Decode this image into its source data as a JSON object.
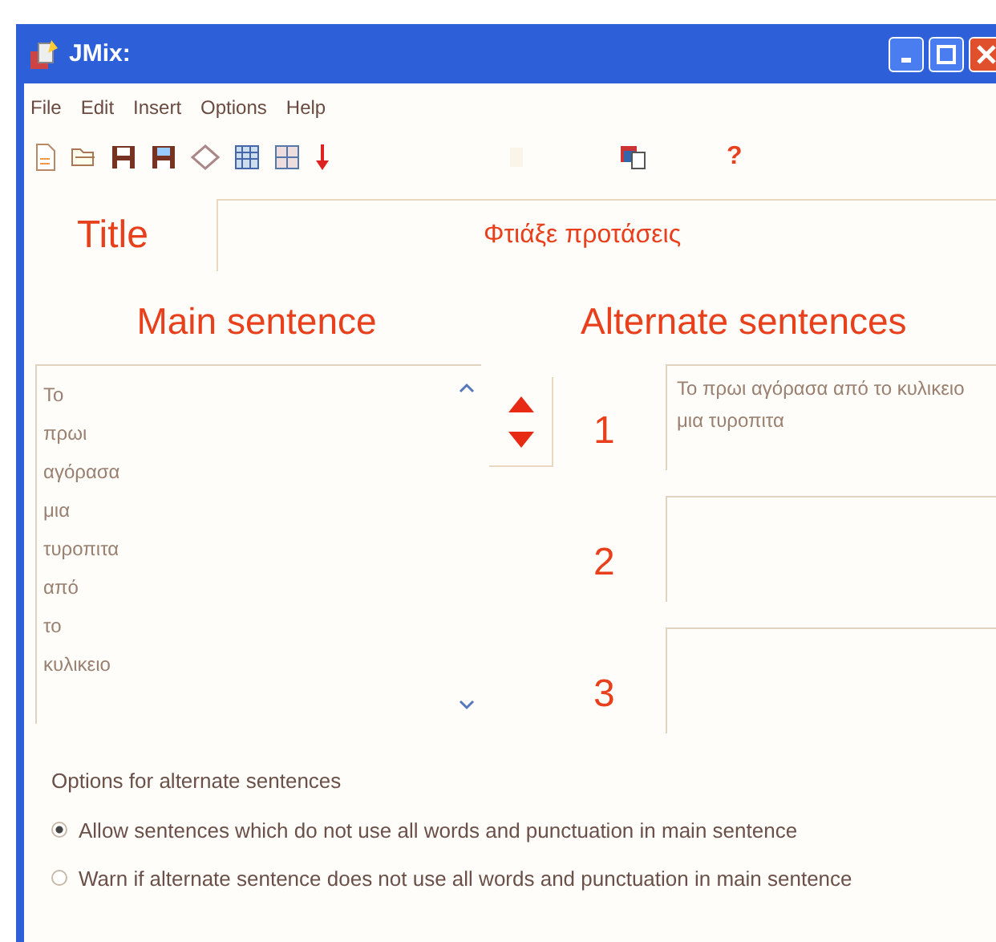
{
  "window": {
    "title": "JMix:"
  },
  "menu": [
    "File",
    "Edit",
    "Insert",
    "Options",
    "Help"
  ],
  "title_field": {
    "label": "Title",
    "value": "Φτιάξε προτάσεις"
  },
  "main_sentence": {
    "heading": "Main sentence",
    "words": [
      "Το",
      "πρωι",
      "αγόρασα",
      "μια",
      "τυροπιτα",
      "από",
      "το",
      "κυλικειο"
    ]
  },
  "alternate_sentences": {
    "heading": "Alternate sentences",
    "items": [
      {
        "number": "1",
        "value": "Το πρωι αγόρασα από το κυλικειο μια τυροπιτα"
      },
      {
        "number": "2"
      },
      {
        "number": "3"
      }
    ]
  },
  "toolbar": {
    "help": "?"
  },
  "options": {
    "heading": "Options for alternate sentences",
    "choices": [
      {
        "label": "Allow sentences which do not use all words and punctuation in main sentence",
        "selected": true
      },
      {
        "label": "Warn if alternate sentence does not use all words and punctuation in main sentence",
        "selected": false
      }
    ]
  }
}
